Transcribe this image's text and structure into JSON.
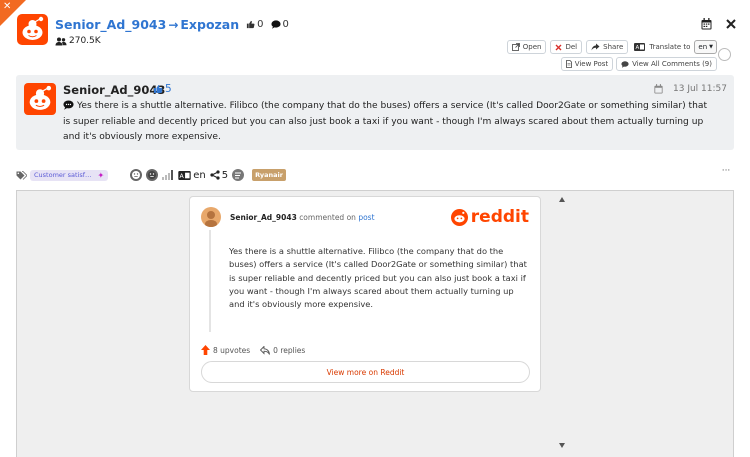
{
  "header": {
    "subreddit": "Senior_Ad_9043",
    "target": "Expozan",
    "upvotes": "0",
    "comments": "0",
    "members": "270.5K"
  },
  "toolbar": {
    "open_label": "Open",
    "del_label": "Del",
    "share_label": "Share",
    "translate_label": "Translate to",
    "language_value": "en",
    "view_post_label": "View Post",
    "view_all_label": "View All Comments (9)"
  },
  "comment": {
    "author": "Senior_Ad_9043",
    "votes": "5",
    "date": "13 Jul 11:57",
    "text": "Yes there is a shuttle alternative. Filibco (the company that do the buses) offers a service (It's called Door2Gate or something similar) that is super reliable and decently priced but you can also just book a taxi if you want - though I'm always scared about them actually turning up and it's obviously more expensive."
  },
  "meta": {
    "tag": "Customer satisf…",
    "tag_plus": "✦",
    "language": "en",
    "shares": "5",
    "brand": "Ryanair",
    "more": "···"
  },
  "embed": {
    "author": "Senior_Ad_9043",
    "commented_on": "commented on",
    "post_link": "post",
    "logo_text": "reddit",
    "body": "Yes there is a shuttle alternative. Filibco (the company that do the buses) offers a service (It's called Door2Gate or something similar) that is super reliable and decently priced but you can also just book a taxi if you want - though I'm always scared about them actually turning up and it's obviously more expensive.",
    "upvotes": "8 upvotes",
    "replies": "0 replies",
    "view_more": "View more on Reddit"
  },
  "colors": {
    "accent": "#2f75d1",
    "reddit_orange": "#ff4500",
    "corner": "#f26a21",
    "brand_badge": "#c8a06b",
    "tag_bg": "#e7e3f5"
  }
}
